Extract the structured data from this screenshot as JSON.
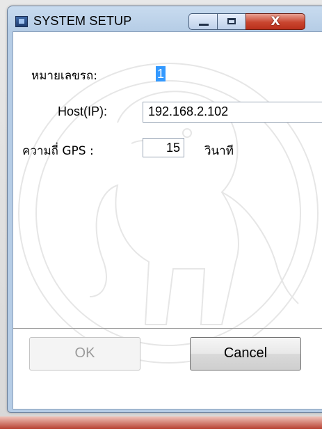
{
  "window": {
    "title": "SYSTEM SETUP",
    "close_glyph": "X"
  },
  "form": {
    "bus_number_label": "หมายเลขรถ:",
    "bus_number_value": "1",
    "host_label": "Host(IP):",
    "host_value": "192.168.2.102",
    "gps_label": "ความถี่ GPS :",
    "gps_value": "15",
    "gps_unit": "วินาที"
  },
  "buttons": {
    "ok_label": "OK",
    "cancel_label": "Cancel"
  },
  "icons": {
    "app": "window-app-icon",
    "minimize": "minimize-icon",
    "maximize": "maximize-icon",
    "close": "close-icon"
  },
  "colors": {
    "titlebar": "#b6cde6",
    "close_button": "#c9452f",
    "selection": "#3399ff"
  }
}
